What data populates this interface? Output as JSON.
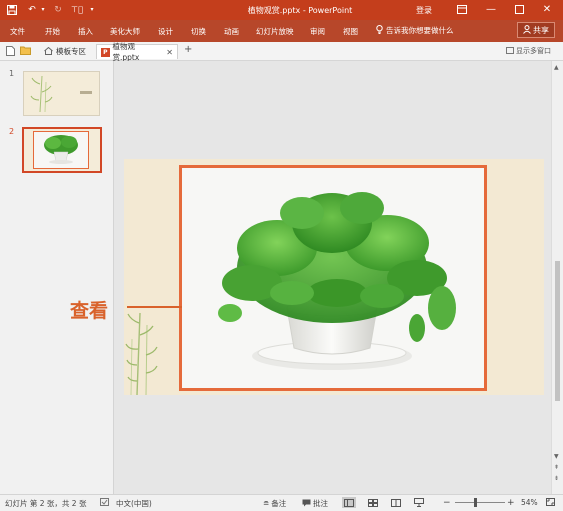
{
  "titlebar": {
    "title": "植物观赏.pptx - PowerPoint",
    "login": "登录",
    "icons": [
      "save-icon",
      "undo-icon",
      "redo-icon",
      "customize-icon"
    ]
  },
  "ribbon": {
    "tabs": [
      "文件",
      "开始",
      "插入",
      "美化大师",
      "设计",
      "切换",
      "动画",
      "幻灯片放映",
      "审阅",
      "视图"
    ],
    "tell_me": "告诉我你想要做什么",
    "share": "共享"
  },
  "docbar": {
    "tab1": "模板专区",
    "tab2": "植物观赏.pptx",
    "show_windows": "显示多窗口",
    "new_tab": "+"
  },
  "thumbnails": {
    "slide1_number": "1",
    "slide2_number": "2"
  },
  "annotation": {
    "text": "查看"
  },
  "statusbar": {
    "slide_info": "幻灯片 第 2 张，共 2 张",
    "language": "中文(中国)",
    "notes": "备注",
    "comments": "批注",
    "zoom": "54%"
  },
  "colors": {
    "titlebar": "#c43e1c",
    "ribbon": "#b7472a",
    "accent": "#e56a3a",
    "annotation": "#d9622b"
  }
}
